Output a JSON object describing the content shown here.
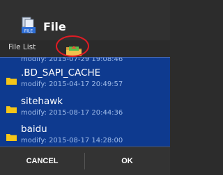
{
  "dialog": {
    "title": "File",
    "icon": "file-manager-icon",
    "app_icon_text": "FILE"
  },
  "path_bar": {
    "label": "File List",
    "up_icon": "folder-up-icon"
  },
  "list": {
    "partial_top_meta": "modify: 2015-07-29 19:08:46",
    "items": [
      {
        "name": ".BD_SAPI_CACHE",
        "meta": "modify: 2015-04-17 20:49:57",
        "icon": "folder-icon"
      },
      {
        "name": "sitehawk",
        "meta": "modify: 2015-08-17 20:44:36",
        "icon": "folder-icon"
      },
      {
        "name": "baidu",
        "meta": "modify: 2015-08-17 14:28:00",
        "icon": "folder-icon"
      }
    ]
  },
  "buttons": {
    "cancel": "CANCEL",
    "ok": "OK"
  },
  "colors": {
    "list_background": "#0e3a8f",
    "highlight_circle": "#e01b24",
    "folder": "#f5c518"
  }
}
